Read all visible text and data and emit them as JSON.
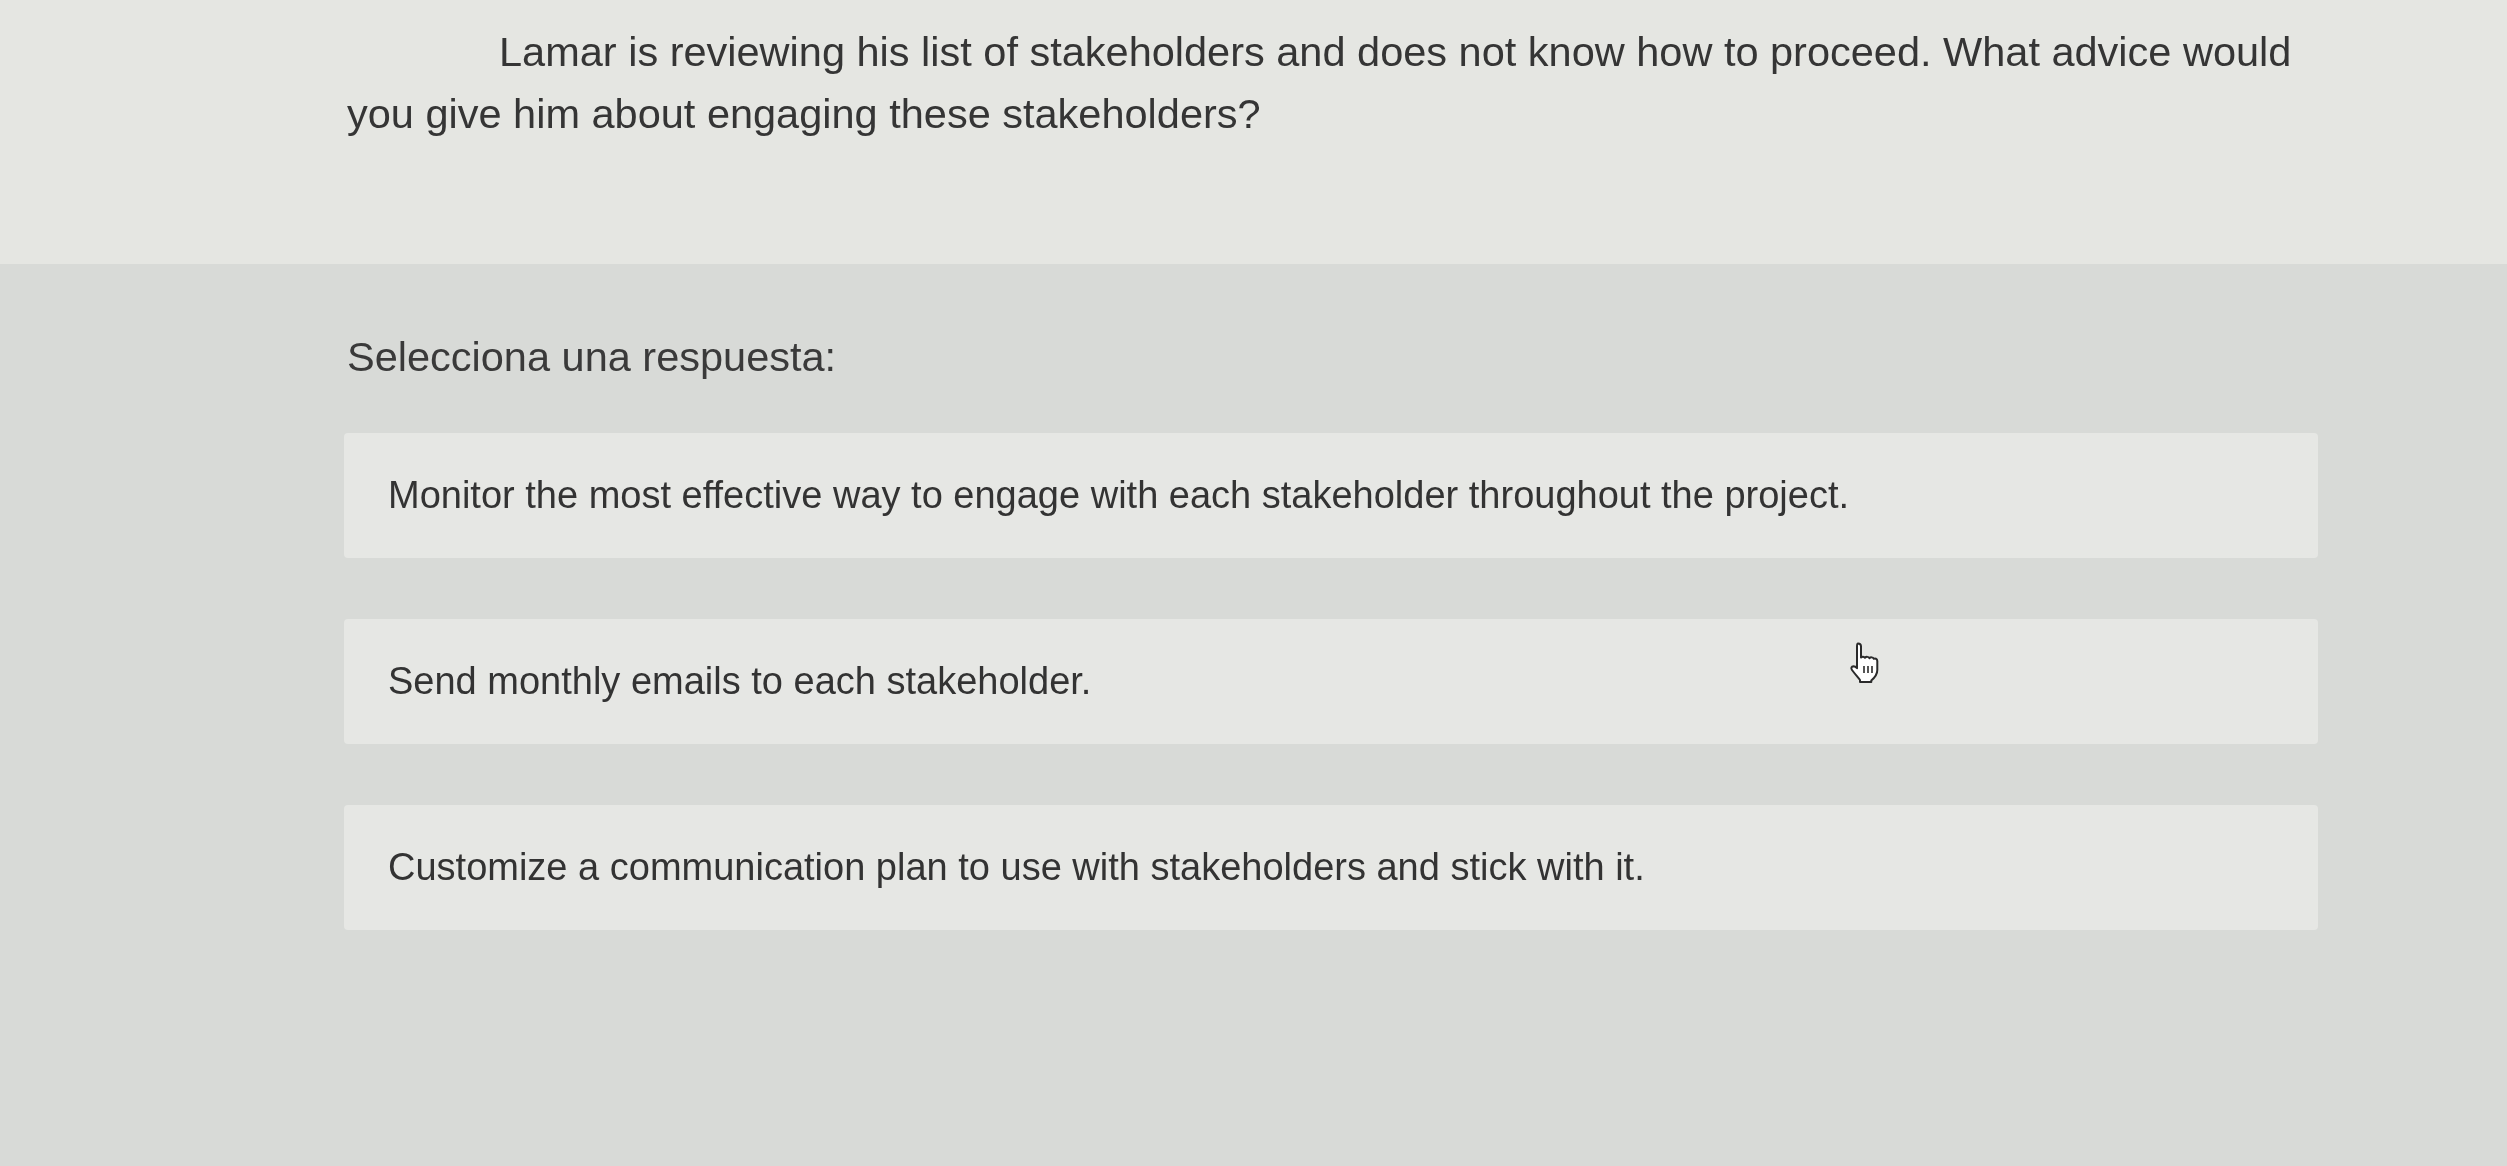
{
  "question": {
    "text": "Lamar is reviewing his list of stakeholders and does not know how to proceed. What advice would you give him about engaging these stakeholders?"
  },
  "prompt": "Selecciona una respuesta:",
  "options": [
    {
      "text": "Monitor the most effective way to engage with each stakeholder throughout the project.",
      "selected": false
    },
    {
      "text": "Send monthly emails to each stakeholder.",
      "selected": false
    },
    {
      "text": "Customize a communication plan to use with stakeholders and stick with it.",
      "selected": false
    }
  ]
}
